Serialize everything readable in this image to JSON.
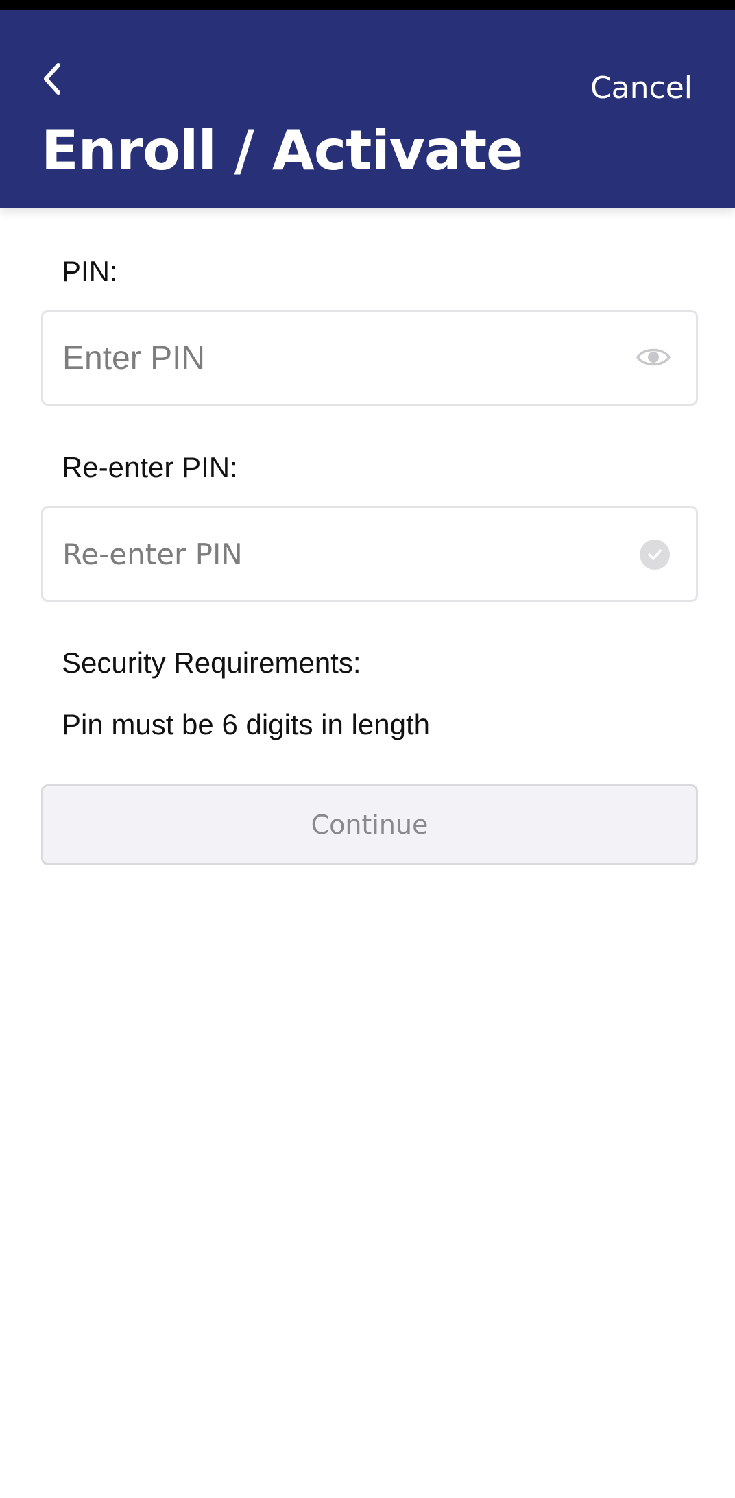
{
  "header": {
    "title": "Enroll / Activate",
    "cancel_label": "Cancel",
    "back_icon": "chevron-left-icon",
    "background_color": "#283177"
  },
  "form": {
    "pin": {
      "label": "PIN:",
      "placeholder": "Enter PIN",
      "value": "",
      "icon": "eye-icon"
    },
    "repin": {
      "label": "Re-enter PIN:",
      "placeholder": "Re-enter PIN",
      "value": "",
      "icon": "check-circle-icon"
    },
    "security": {
      "heading": "Security Requirements:",
      "rule": "Pin must be 6 digits in length"
    },
    "continue_label": "Continue",
    "continue_enabled": false
  }
}
